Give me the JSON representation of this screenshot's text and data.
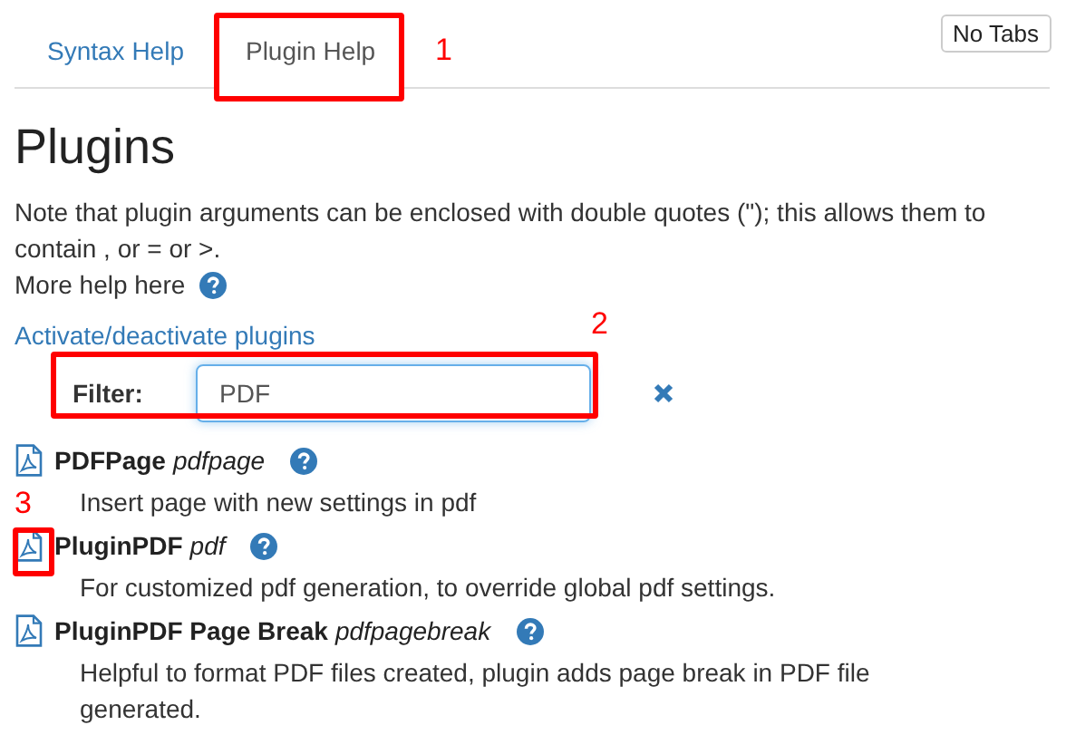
{
  "tabs": [
    {
      "label": "Syntax Help",
      "selected": false
    },
    {
      "label": "Plugin Help",
      "selected": true
    }
  ],
  "no_tabs_button": "No Tabs",
  "heading": "Plugins",
  "note": "Note that plugin arguments can be enclosed with double quotes (\"); this allows them to contain , or = or >.",
  "more_help": "More help here",
  "activate_link": "Activate/deactivate plugins",
  "filter": {
    "label": "Filter:",
    "value": "PDF"
  },
  "plugins": [
    {
      "name": "PDFPage",
      "command": "pdfpage",
      "description": "Insert page with new settings in pdf"
    },
    {
      "name": "PluginPDF",
      "command": "pdf",
      "description": "For customized pdf generation, to override global pdf settings."
    },
    {
      "name": "PluginPDF Page Break",
      "command": "pdfpagebreak",
      "description": "Helpful to format PDF files created, plugin adds page break in PDF file generated."
    }
  ],
  "annotations": [
    {
      "label": "1"
    },
    {
      "label": "2"
    },
    {
      "label": "3"
    }
  ]
}
